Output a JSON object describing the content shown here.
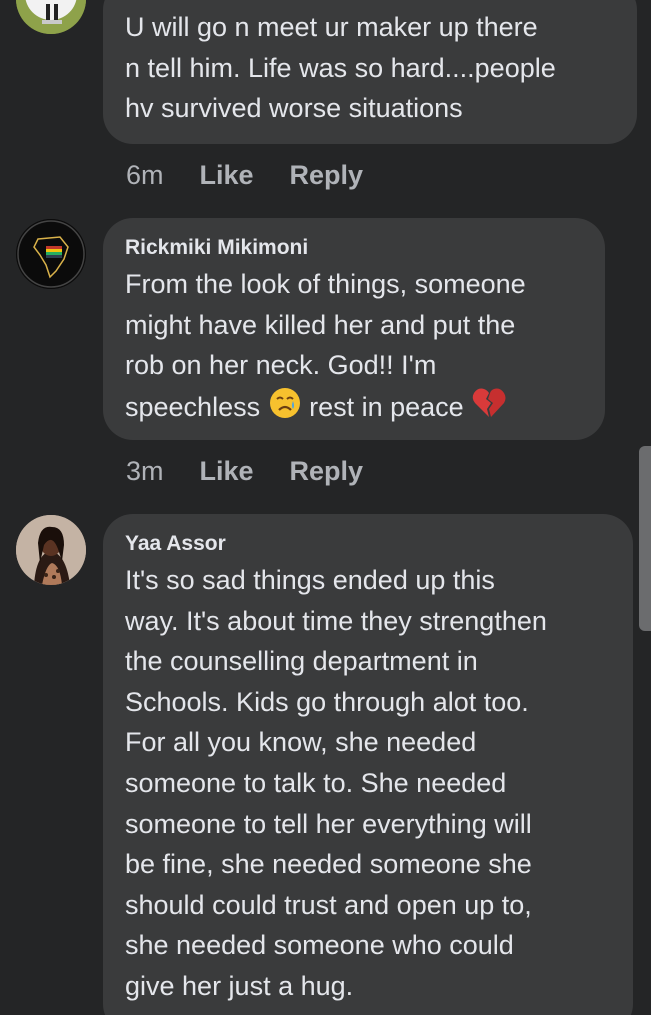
{
  "comments": [
    {
      "author": "",
      "text": "U will go n meet ur maker up there\nn tell him. Life was so hard....people\nhv survived worse situations",
      "time": "6m",
      "like_label": "Like",
      "reply_label": "Reply"
    },
    {
      "author": "Rickmiki Mikimoni",
      "text_main": "From the look of things, someone\nmight have killed her and put the\nrob on her neck. God!! I'm\nspeechless ",
      "text_mid": " rest in peace ",
      "emoji_1": "crying-face",
      "emoji_2": "broken-heart",
      "time": "3m",
      "like_label": "Like",
      "reply_label": "Reply"
    },
    {
      "author": "Yaa Assor",
      "text": "It's so sad things ended up this\nway. It's about time they strengthen\nthe counselling department in\nSchools. Kids go through alot too.\nFor all you know, she needed\nsomeone to talk to. She needed\nsomeone to tell her everything will\nbe fine, she needed someone she\nshould could trust and open up to,\nshe needed someone who could\ngive her just a hug."
    }
  ],
  "colors": {
    "background": "#242526",
    "bubble": "#3a3b3c",
    "text": "#e4e6eb",
    "secondary": "#b0b3b8"
  }
}
